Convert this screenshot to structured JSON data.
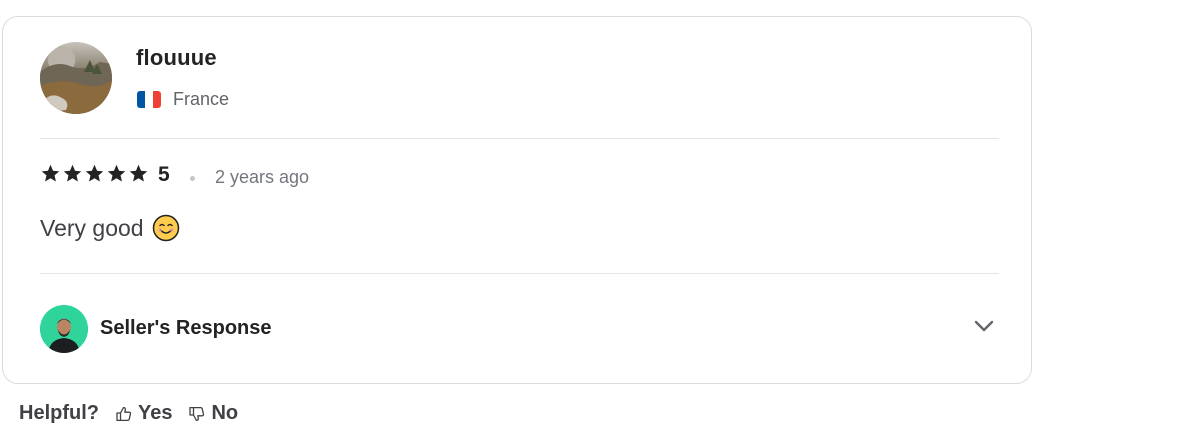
{
  "reviewer": {
    "username": "flouuue",
    "country": "France",
    "flag_colors": [
      "#0055a4",
      "#ffffff",
      "#ef4135"
    ]
  },
  "review": {
    "stars": 5,
    "rating_text": "5",
    "time_ago": "2 years ago",
    "text": "Very good",
    "emoji": "smiling-face-icon"
  },
  "seller_response": {
    "title": "Seller's Response",
    "expanded": false
  },
  "helpful": {
    "label": "Helpful?",
    "yes_label": "Yes",
    "no_label": "No"
  },
  "colors": {
    "star": "#222325",
    "seller_avatar_bg": "#2fd49b"
  }
}
